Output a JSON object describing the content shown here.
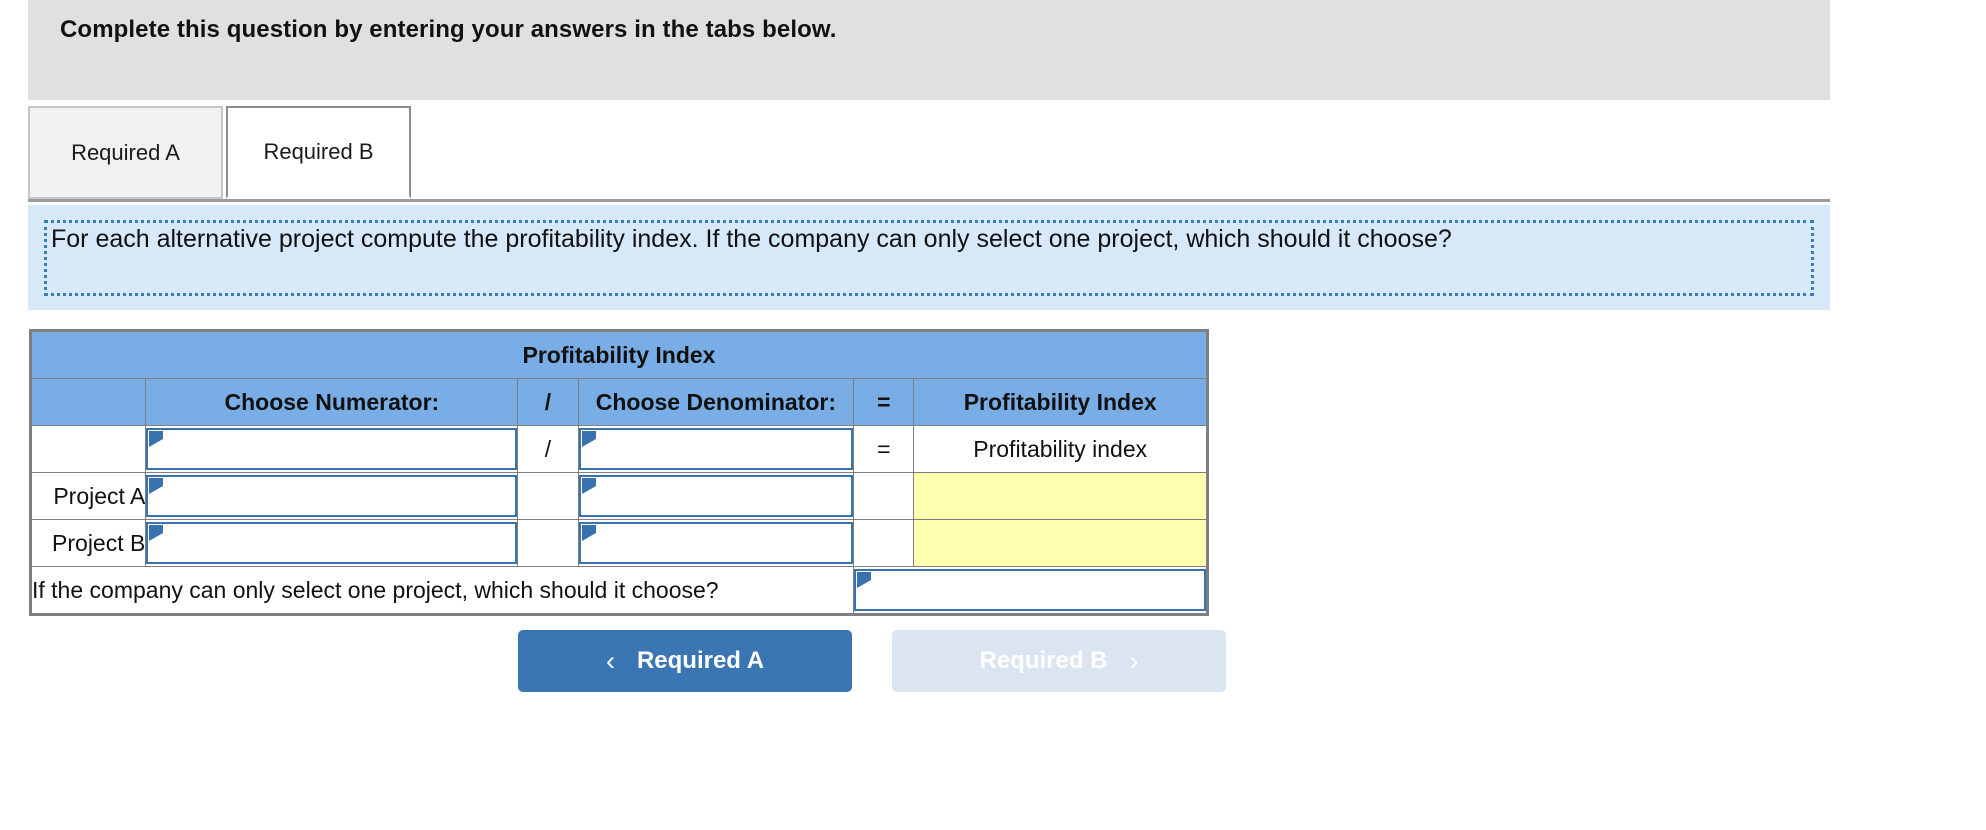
{
  "header": {
    "instruction": "Complete this question by entering your answers in the tabs below."
  },
  "tabs": [
    {
      "id": "required-a",
      "label": "Required A",
      "active": false
    },
    {
      "id": "required-b",
      "label": "Required B",
      "active": true
    }
  ],
  "question": {
    "text": "For each alternative project compute the profitability index. If the company can only select one project, which should it choose?"
  },
  "table": {
    "title": "Profitability Index",
    "columns": [
      {
        "key": "row_label",
        "label": ""
      },
      {
        "key": "numerator",
        "label": "Choose Numerator:"
      },
      {
        "key": "divider",
        "label": "/"
      },
      {
        "key": "denominator",
        "label": "Choose Denominator:"
      },
      {
        "key": "equals",
        "label": "="
      },
      {
        "key": "result",
        "label": "Profitability Index"
      }
    ],
    "rows": [
      {
        "name": "formula-row",
        "row_label": "",
        "numerator": "",
        "divider": "/",
        "denominator": "",
        "equals": "=",
        "result": "Profitability index",
        "result_style": "plain"
      },
      {
        "name": "project-a-row",
        "row_label": "Project A",
        "numerator": "",
        "divider": "",
        "denominator": "",
        "equals": "",
        "result": "",
        "result_style": "yellow"
      },
      {
        "name": "project-b-row",
        "row_label": "Project B",
        "numerator": "",
        "divider": "",
        "denominator": "",
        "equals": "",
        "result": "",
        "result_style": "yellow"
      }
    ],
    "final_row": {
      "prompt": "If the company can only select one project, which should it choose?",
      "answer": ""
    }
  },
  "footer": {
    "prev_button": {
      "label": "Required A",
      "icon": "chevron-left-icon",
      "glyph": "‹",
      "enabled": true
    },
    "next_button": {
      "label": "Required B",
      "icon": "chevron-right-icon",
      "glyph": "›",
      "enabled": false
    }
  },
  "colors": {
    "header_gray": "#e0e0e0",
    "table_header_blue": "#79ade6",
    "question_panel_blue": "#d7e8f8",
    "dotted_border_blue": "#3a7cbd",
    "input_border_blue": "#3a72ad",
    "answer_yellow": "#ffffb0",
    "primary_button": "#3b76b4",
    "disabled_button": "#dbe5f1"
  }
}
